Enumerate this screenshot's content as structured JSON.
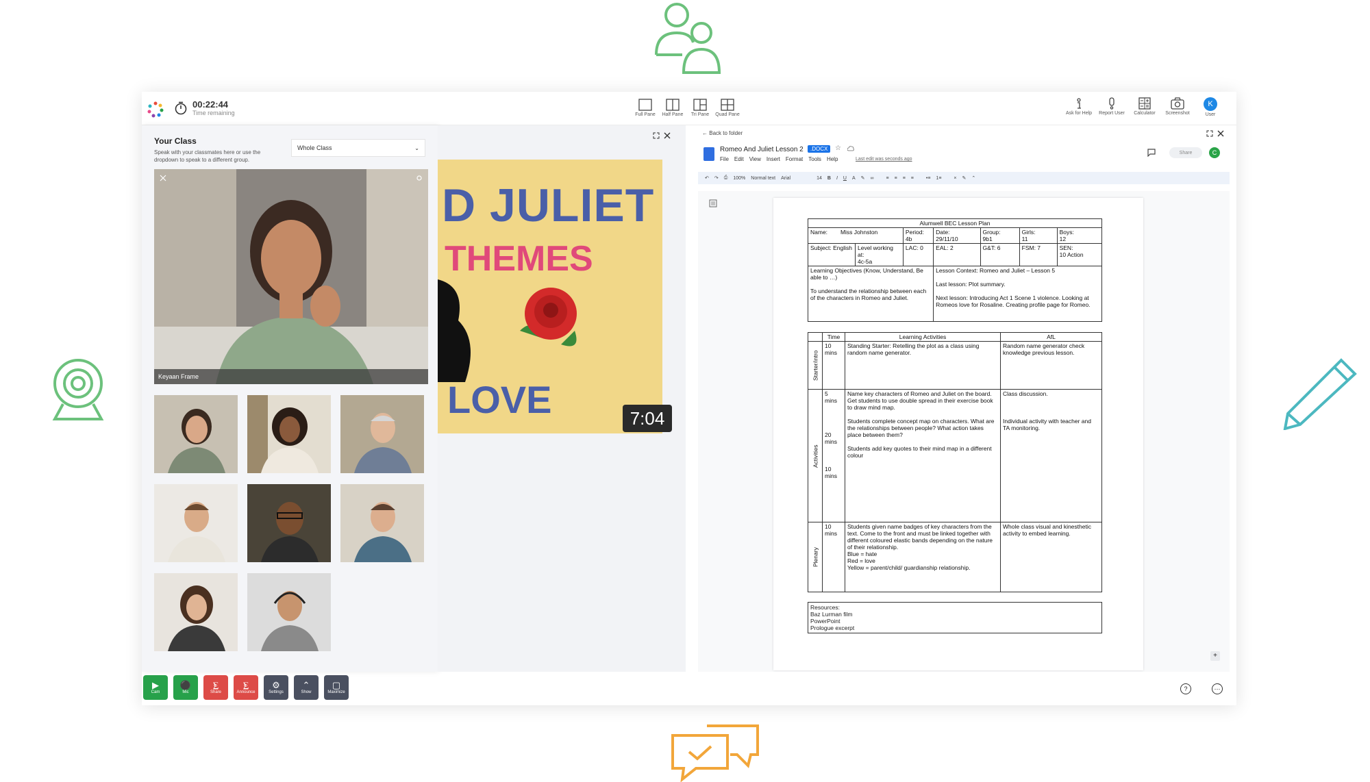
{
  "topbar": {
    "timer": "00:22:44",
    "timer_sub": "Time remaining",
    "panes": [
      "Full Pane",
      "Half Pane",
      "Tri Pane",
      "Quad Pane"
    ],
    "tools": [
      "Ask for Help",
      "Report User",
      "Calculator",
      "Screenshot",
      "User"
    ],
    "user_initial": "K"
  },
  "class_panel": {
    "title": "Your Class",
    "subtitle": "Speak with your classmates here or use the dropdown to speak to a different group.",
    "dropdown": "Whole Class",
    "main_video_name": "Keyaan Frame"
  },
  "slide": {
    "line1": "D JULIET",
    "line2": "THEMES",
    "line3": "LOVE",
    "duration": "7:04"
  },
  "doc": {
    "back": "Back to folder",
    "title": "Romeo And Juliet Lesson 2",
    "badge": ".DOCX",
    "menu": [
      "File",
      "Edit",
      "View",
      "Insert",
      "Format",
      "Tools",
      "Help"
    ],
    "edited": "Last edit was seconds ago",
    "share": "Share",
    "avatar": "C",
    "zoom": "100%",
    "style": "Normal text",
    "font": "Arial",
    "size": "14",
    "plan": {
      "header": "Alumwell BEC Lesson Plan",
      "name_label": "Name:",
      "name_value": "Miss Johnston",
      "period": "Period:\n4b",
      "date": "Date:\n29/11/10",
      "group": "Group:\n9b1",
      "girls": "Girls:\n11",
      "boys": "Boys:\n12",
      "subject": "Subject: English",
      "level": "Level working at:\n4c-5a",
      "lac": "LAC: 0",
      "eal": "EAL: 2",
      "gt": "G&T: 6",
      "fsm": "FSM: 7",
      "sen": "SEN:\n10 Action",
      "objectives": "Learning Objectives (Know, Understand, Be able to …)\n\nTo understand the relationship between each of the characters in Romeo and Juliet.",
      "context": "Lesson Context: Romeo and Juliet – Lesson 5\n\nLast lesson: Plot summary.\n\nNext lesson: Introducing Act 1 Scene 1 violence. Looking at Romeos love for Rosaline. Creating profile page for Romeo.",
      "col_time": "Time",
      "col_activities": "Learning Activities",
      "col_afl": "AfL",
      "starter_label": "Starter/intro",
      "starter_time": "10\nmins",
      "starter_act": "Standing Starter: Retelling the plot as a class using random name generator.",
      "starter_afl": "Random name generator check knowledge previous lesson.",
      "activities_label": "Activities",
      "act_time": "5\nmins\n\n\n\n\n20\nmins\n\n\n\n10\nmins",
      "act_text": "Name key characters of Romeo and Juliet on the board. Get students to use double spread in their exercise book to draw mind map.\n\nStudents complete concept map on characters. What are the relationships between people? What action takes place between them?\n\nStudents add key quotes to their mind map in a different colour",
      "act_afl": "Class discussion.\n\n\n\nIndividual activity with teacher and TA monitoring.",
      "plenary_label": "Plenary",
      "plenary_time": "10\nmins",
      "plenary_act": "Students given name badges of key characters from the text. Come to the front and must be linked together with different coloured elastic bands depending on the nature of their relationship.\nBlue = hate\nRed = love\nYellow = parent/child/ guardianship relationship.",
      "plenary_afl": "Whole class visual and kinesthetic activity to embed learning.",
      "resources": "Resources:\nBaz Lurman film\nPowerPoint\nPrologue excerpt"
    }
  },
  "controls": [
    "Cam",
    "Mic",
    "Share",
    "Announce",
    "Settings",
    "Show",
    "Maximize"
  ],
  "colors": {
    "green": "#27a14a",
    "red": "#dd4b47",
    "dark": "#4a5060",
    "accent": "#1a73e8",
    "deco_green": "#6cc17c",
    "deco_teal": "#4cb8c0",
    "deco_orange": "#f2a63a"
  }
}
